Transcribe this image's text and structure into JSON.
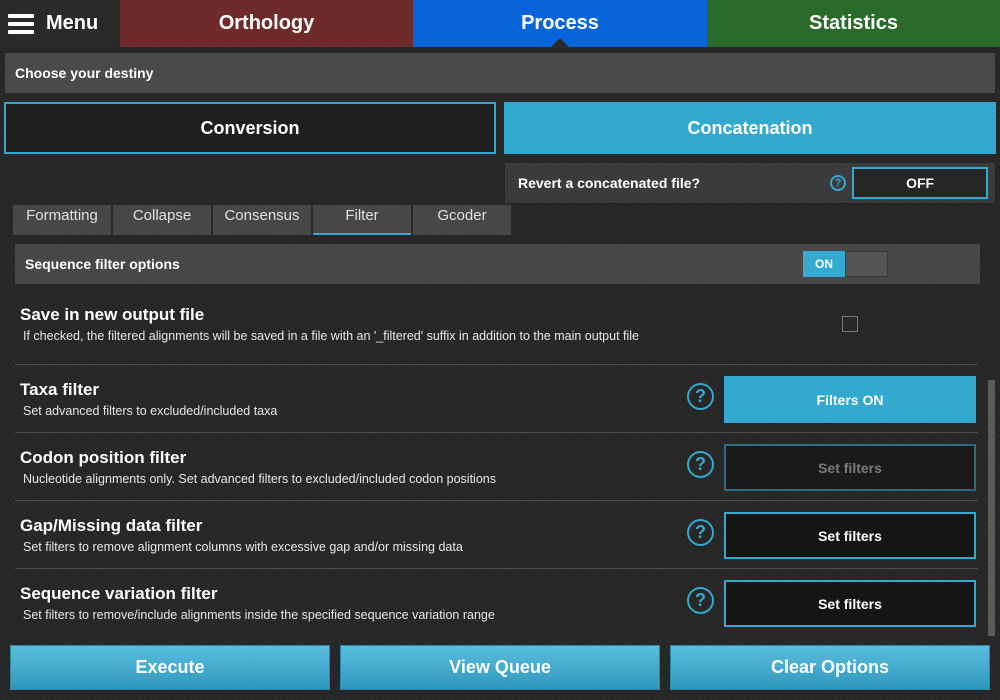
{
  "top_nav": {
    "menu_label": "Menu",
    "tabs": [
      "Orthology",
      "Process",
      "Statistics"
    ],
    "active_tab": "Process"
  },
  "destiny": {
    "label": "Choose your destiny"
  },
  "modes": {
    "conversion": "Conversion",
    "concatenation": "Concatenation"
  },
  "revert": {
    "label": "Revert a concatenated file?",
    "help_icon": "?",
    "value": "OFF"
  },
  "sub_tabs": [
    "Formatting",
    "Collapse",
    "Consensus",
    "Filter",
    "Gcoder"
  ],
  "active_sub_tab": "Filter",
  "sequence_filter": {
    "label": "Sequence filter options",
    "toggle": "ON"
  },
  "options": [
    {
      "title": "Save in new output file",
      "desc": "If checked, the filtered alignments will be saved in a file with an '_filtered' suffix in addition to the main output file"
    },
    {
      "title": "Taxa filter",
      "desc": "Set advanced filters to excluded/included taxa",
      "help_icon": "?",
      "button": "Filters ON"
    },
    {
      "title": "Codon position filter",
      "desc": "Nucleotide alignments only. Set advanced filters to excluded/included codon positions",
      "help_icon": "?",
      "button": "Set filters"
    },
    {
      "title": "Gap/Missing data filter",
      "desc": "Set filters to remove alignment columns with excessive gap and/or missing data",
      "help_icon": "?",
      "button": "Set filters"
    },
    {
      "title": "Sequence variation filter",
      "desc": "Set filters to remove/include alignments inside the specified sequence variation range",
      "help_icon": "?",
      "button": "Set filters"
    }
  ],
  "bottom": {
    "execute": "Execute",
    "view_queue": "View Queue",
    "clear": "Clear Options"
  },
  "colors": {
    "accent": "#33a9cf",
    "orthology": "#6f2b2b",
    "process": "#0864d9",
    "statistics": "#2a6a2a"
  }
}
